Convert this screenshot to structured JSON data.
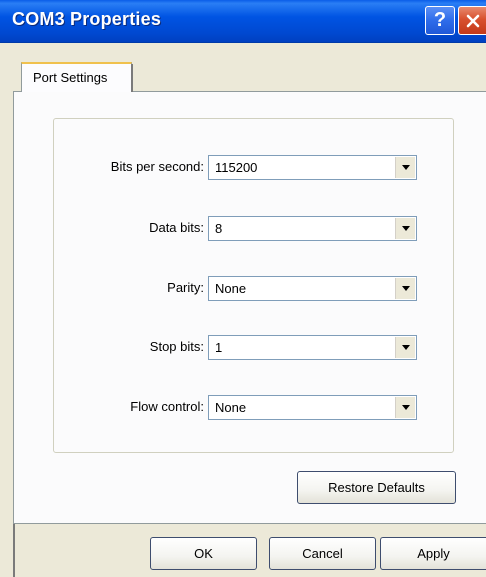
{
  "window": {
    "title": "COM3 Properties",
    "help_label": "?"
  },
  "tabs": [
    {
      "label": "Port Settings",
      "selected": true
    }
  ],
  "fields": [
    {
      "label": "Bits per second:",
      "value": "115200"
    },
    {
      "label": "Data bits:",
      "value": "8"
    },
    {
      "label": "Parity:",
      "value": "None"
    },
    {
      "label": "Stop bits:",
      "value": "1"
    },
    {
      "label": "Flow control:",
      "value": "None"
    }
  ],
  "buttons": {
    "restore_defaults": "Restore Defaults",
    "ok": "OK",
    "cancel": "Cancel",
    "apply": "Apply"
  },
  "icons": {
    "help": "help-icon",
    "close": "close-icon",
    "dropdown": "chevron-down-icon"
  },
  "colors": {
    "titlebar": "#0054e3",
    "close_button": "#d8512f",
    "tab_highlight": "#f0c14d",
    "window_face": "#ece9d8"
  }
}
